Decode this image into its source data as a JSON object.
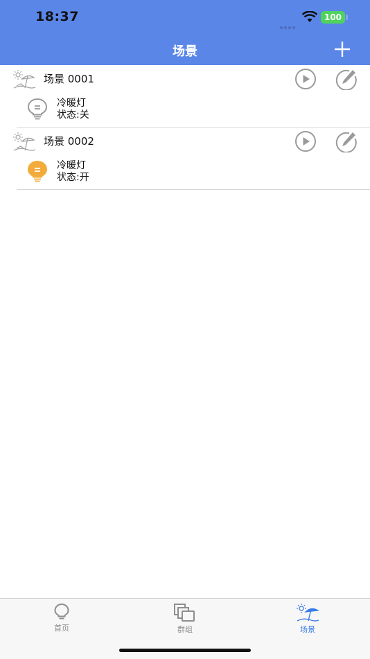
{
  "status_bar": {
    "time": "18:37",
    "battery": "100"
  },
  "nav": {
    "title": "场景"
  },
  "scenes": [
    {
      "name": "场景 0001",
      "device": {
        "name": "冷暖灯",
        "status": "状态:关",
        "state": "off"
      }
    },
    {
      "name": "场景 0002",
      "device": {
        "name": "冷暖灯",
        "status": "状态:开",
        "state": "on"
      }
    }
  ],
  "tabbar": {
    "items": [
      {
        "label": "首页",
        "icon": "bulb-icon",
        "active": false
      },
      {
        "label": "群组",
        "icon": "group-icon",
        "active": false
      },
      {
        "label": "场景",
        "icon": "scene-icon",
        "active": true
      }
    ]
  },
  "colors": {
    "header": "#5a86e8",
    "accent": "#3a7be8",
    "bulb_on": "#f3ac3c",
    "bulb_off": "#9a9a9a"
  }
}
